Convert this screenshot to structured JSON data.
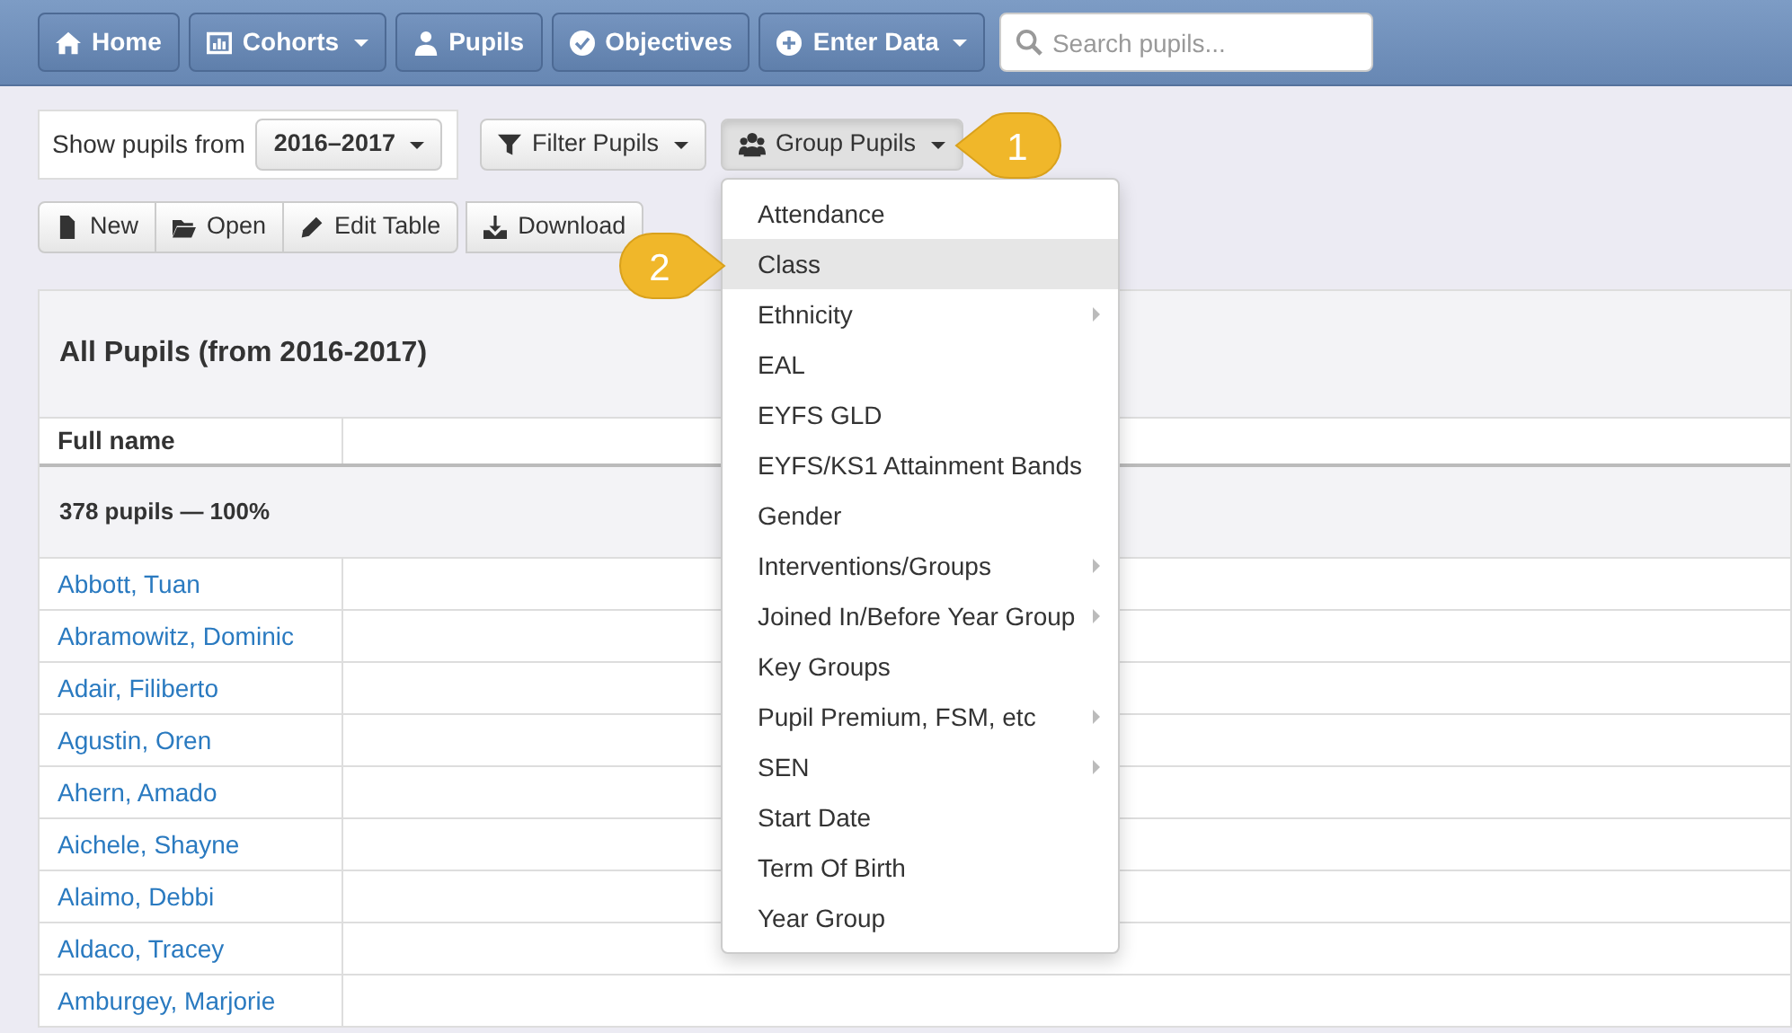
{
  "navbar": {
    "items": [
      {
        "label": "Home",
        "dropdown": false
      },
      {
        "label": "Cohorts",
        "dropdown": true
      },
      {
        "label": "Pupils",
        "dropdown": false
      },
      {
        "label": "Objectives",
        "dropdown": false
      },
      {
        "label": "Enter Data",
        "dropdown": true
      }
    ],
    "search": {
      "placeholder": "Search pupils..."
    }
  },
  "year_picker": {
    "label": "Show pupils from",
    "value": "2016–2017"
  },
  "filter_button": "Filter Pupils",
  "group_button": "Group Pupils",
  "toolbar": [
    {
      "label": "New"
    },
    {
      "label": "Open"
    },
    {
      "label": "Edit Table"
    },
    {
      "label": "Download"
    }
  ],
  "group_menu": [
    {
      "label": "Attendance",
      "highlighted": false,
      "submenu": false
    },
    {
      "label": "Class",
      "highlighted": true,
      "submenu": false
    },
    {
      "label": "Ethnicity",
      "highlighted": false,
      "submenu": true
    },
    {
      "label": "EAL",
      "highlighted": false,
      "submenu": false
    },
    {
      "label": "EYFS GLD",
      "highlighted": false,
      "submenu": false
    },
    {
      "label": "EYFS/KS1 Attainment Bands",
      "highlighted": false,
      "submenu": false
    },
    {
      "label": "Gender",
      "highlighted": false,
      "submenu": false
    },
    {
      "label": "Interventions/Groups",
      "highlighted": false,
      "submenu": true
    },
    {
      "label": "Joined In/Before Year Group",
      "highlighted": false,
      "submenu": true
    },
    {
      "label": "Key Groups",
      "highlighted": false,
      "submenu": false
    },
    {
      "label": "Pupil Premium, FSM, etc",
      "highlighted": false,
      "submenu": true
    },
    {
      "label": "SEN",
      "highlighted": false,
      "submenu": true
    },
    {
      "label": "Start Date",
      "highlighted": false,
      "submenu": false
    },
    {
      "label": "Term Of Birth",
      "highlighted": false,
      "submenu": false
    },
    {
      "label": "Year Group",
      "highlighted": false,
      "submenu": false
    }
  ],
  "callouts": [
    {
      "number": "1",
      "kind": "left"
    },
    {
      "number": "2",
      "kind": "right"
    }
  ],
  "table": {
    "title": "All Pupils (from 2016-2017)",
    "columns": [
      "Full name"
    ],
    "group_row": "378 pupils — 100%",
    "rows": [
      "Abbott, Tuan",
      "Abramowitz, Dominic",
      "Adair, Filiberto",
      "Agustin, Oren",
      "Ahern, Amado",
      "Aichele, Shayne",
      "Alaimo, Debbi",
      "Aldaco, Tracey",
      "Amburgey, Marjorie"
    ]
  }
}
